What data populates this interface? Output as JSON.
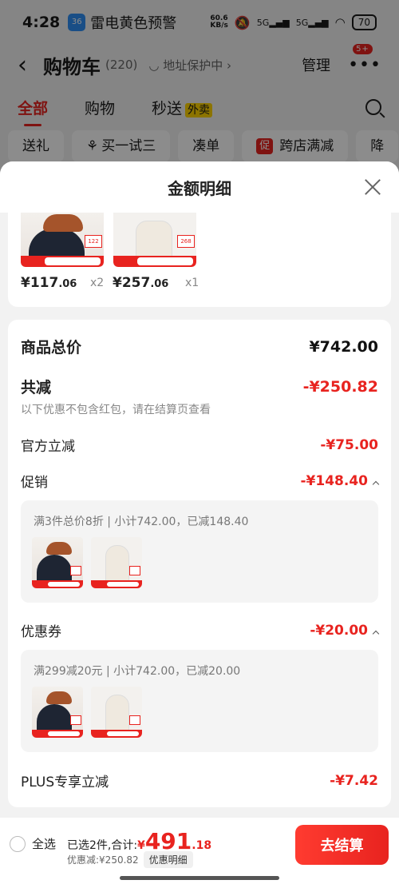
{
  "status_bar": {
    "time": "4:28",
    "weather_badge": "36",
    "alert": "雷电黄色预警",
    "network_speed": "60.6\nKB/s",
    "signal_1": "5G",
    "signal_2": "5G",
    "battery": "70"
  },
  "nav": {
    "back_icon": "chevron-left",
    "title": "购物车",
    "count": "(220)",
    "address": "地址保护中",
    "manage": "管理",
    "more_badge": "5+"
  },
  "tabs": [
    {
      "label": "全部",
      "active": true
    },
    {
      "label": "购物"
    },
    {
      "label": "秒送",
      "tag": "外卖"
    }
  ],
  "chips": [
    {
      "label": "送礼"
    },
    {
      "label": "买一试三"
    },
    {
      "label": "凑单"
    },
    {
      "label": "跨店满减",
      "tag": "促"
    },
    {
      "label": "降"
    }
  ],
  "sheet": {
    "title": "金额明细",
    "products": [
      {
        "price_int": "¥117",
        "price_dec": ".06",
        "qty": "x2",
        "tag_price": "122",
        "strip_price": "159"
      },
      {
        "price_int": "¥257",
        "price_dec": ".06",
        "qty": "x1",
        "tag_price": "268",
        "strip_price": "349"
      }
    ],
    "summary": {
      "total_label": "商品总价",
      "total_value": "¥742.00",
      "reduce_label": "共减",
      "reduce_value": "-¥250.82",
      "reduce_note": "以下优惠不包含红包，请在结算页查看",
      "official_label": "官方立减",
      "official_value": "-¥75.00",
      "promo_label": "促销",
      "promo_value": "-¥148.40",
      "promo_detail": "满3件总价8折 | 小计742.00，已减148.40",
      "coupon_label": "优惠券",
      "coupon_value": "-¥20.00",
      "coupon_detail": "满299减20元 | 小计742.00，已减20.00",
      "plus_label": "PLUS专享立减",
      "plus_value": "-¥7.42"
    }
  },
  "bottom": {
    "select_all": "全选",
    "selected_text": "已选2件,合计:",
    "yen": "¥",
    "total_int": "491",
    "total_dec": ".18",
    "discount_text": "优惠减:¥250.82",
    "detail_button": "优惠明细",
    "checkout": "去结算"
  },
  "colors": {
    "accent": "#e8231f",
    "waimai_bg": "#ffd400"
  }
}
